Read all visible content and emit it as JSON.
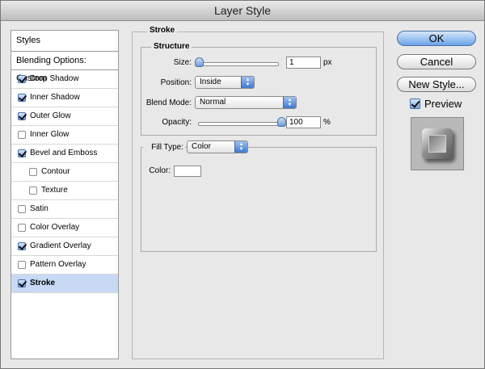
{
  "window": {
    "title": "Layer Style"
  },
  "styles_panel": {
    "header": "Styles",
    "blending_options": "Blending Options: Custom",
    "items": [
      {
        "label": "Drop Shadow",
        "checked": true,
        "sub": false,
        "selected": false
      },
      {
        "label": "Inner Shadow",
        "checked": true,
        "sub": false,
        "selected": false
      },
      {
        "label": "Outer Glow",
        "checked": true,
        "sub": false,
        "selected": false
      },
      {
        "label": "Inner Glow",
        "checked": false,
        "sub": false,
        "selected": false
      },
      {
        "label": "Bevel and Emboss",
        "checked": true,
        "sub": false,
        "selected": false
      },
      {
        "label": "Contour",
        "checked": false,
        "sub": true,
        "selected": false
      },
      {
        "label": "Texture",
        "checked": false,
        "sub": true,
        "selected": false
      },
      {
        "label": "Satin",
        "checked": false,
        "sub": false,
        "selected": false
      },
      {
        "label": "Color Overlay",
        "checked": false,
        "sub": false,
        "selected": false
      },
      {
        "label": "Gradient Overlay",
        "checked": true,
        "sub": false,
        "selected": false
      },
      {
        "label": "Pattern Overlay",
        "checked": false,
        "sub": false,
        "selected": false
      },
      {
        "label": "Stroke",
        "checked": true,
        "sub": false,
        "selected": true
      }
    ]
  },
  "stroke": {
    "title": "Stroke",
    "structure": {
      "title": "Structure",
      "size_label": "Size:",
      "size_value": "1",
      "size_unit": "px",
      "position_label": "Position:",
      "position_value": "Inside",
      "blend_mode_label": "Blend Mode:",
      "blend_mode_value": "Normal",
      "opacity_label": "Opacity:",
      "opacity_value": "100",
      "opacity_unit": "%"
    },
    "fill": {
      "fill_type_label": "Fill Type:",
      "fill_type_value": "Color",
      "color_label": "Color:",
      "color_value": "#ffffff"
    }
  },
  "buttons": {
    "ok": "OK",
    "cancel": "Cancel",
    "new_style": "New Style...",
    "preview_label": "Preview",
    "preview_checked": true
  },
  "colors": {
    "accent": "#6aa4ea",
    "selected_row": "#c7d9f4"
  }
}
